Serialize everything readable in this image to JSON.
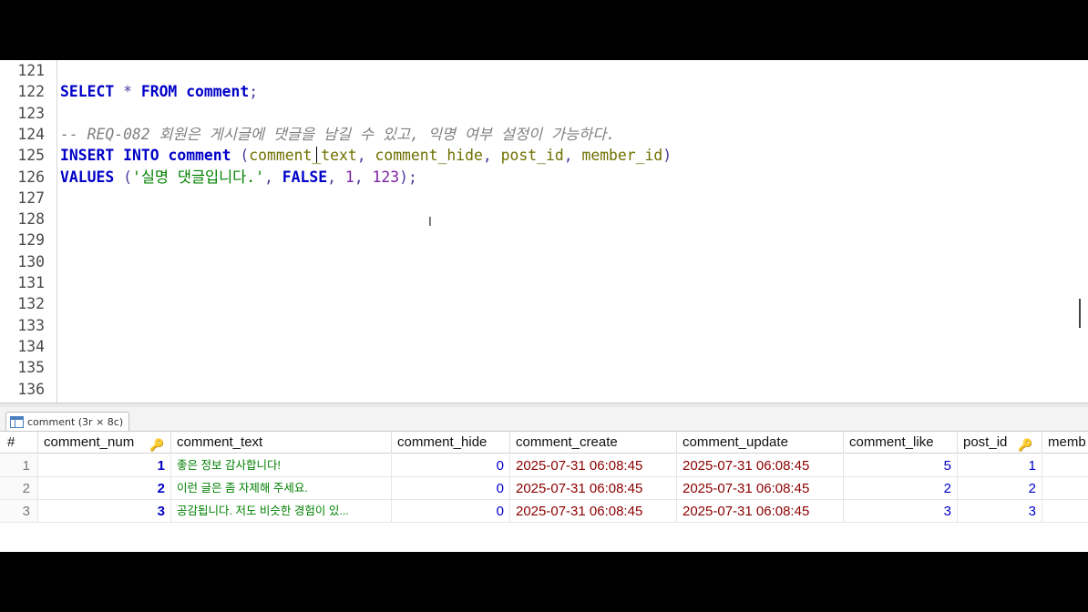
{
  "editor": {
    "lines": [
      {
        "n": "121",
        "tokens": []
      },
      {
        "n": "122",
        "tokens": [
          [
            "kw",
            "SELECT"
          ],
          [
            "op",
            " * "
          ],
          [
            "kw",
            "FROM"
          ],
          [
            "op",
            " "
          ],
          [
            "kw",
            "comment"
          ],
          [
            "op",
            ";"
          ]
        ]
      },
      {
        "n": "123",
        "tokens": []
      },
      {
        "n": "124",
        "tokens": [
          [
            "cmt",
            "-- REQ-082 회원은 게시글에 댓글을 남길 수 있고, 익명 여부 설정이 가능하다."
          ]
        ]
      },
      {
        "n": "125",
        "tokens": [
          [
            "kw",
            "INSERT"
          ],
          [
            "op",
            " "
          ],
          [
            "kw",
            "INTO"
          ],
          [
            "op",
            " "
          ],
          [
            "kw",
            "comment"
          ],
          [
            "op",
            " ("
          ],
          [
            "ident",
            "comment_text"
          ],
          [
            "op",
            ", "
          ],
          [
            "ident",
            "comment_hide"
          ],
          [
            "op",
            ", "
          ],
          [
            "ident",
            "post_id"
          ],
          [
            "op",
            ", "
          ],
          [
            "ident",
            "member_id"
          ],
          [
            "op",
            ")"
          ]
        ]
      },
      {
        "n": "126",
        "tokens": [
          [
            "kw",
            "VALUES"
          ],
          [
            "op",
            " ("
          ],
          [
            "str",
            "'실명 댓글입니다.'"
          ],
          [
            "op",
            ", "
          ],
          [
            "kw",
            "FALSE"
          ],
          [
            "op",
            ", "
          ],
          [
            "num",
            "1"
          ],
          [
            "op",
            ", "
          ],
          [
            "num",
            "123"
          ],
          [
            "op",
            ");"
          ]
        ]
      },
      {
        "n": "127",
        "tokens": []
      },
      {
        "n": "128",
        "tokens": []
      },
      {
        "n": "129",
        "tokens": []
      },
      {
        "n": "130",
        "tokens": []
      },
      {
        "n": "131",
        "tokens": []
      },
      {
        "n": "132",
        "tokens": []
      },
      {
        "n": "133",
        "tokens": []
      },
      {
        "n": "134",
        "tokens": []
      },
      {
        "n": "135",
        "tokens": []
      },
      {
        "n": "136",
        "tokens": []
      }
    ],
    "cursor_glyph": "I"
  },
  "results": {
    "tab_label": "comment (3r × 8c)",
    "row_header": "#",
    "key_glyph": "🔑",
    "columns": [
      "comment_num",
      "comment_text",
      "comment_hide",
      "comment_create",
      "comment_update",
      "comment_like",
      "post_id",
      "memb"
    ],
    "rows": [
      {
        "rn": "1",
        "comment_num": "1",
        "comment_text": "좋은 정보 감사합니다!",
        "comment_hide": "0",
        "comment_create": "2025-07-31 06:08:45",
        "comment_update": "2025-07-31 06:08:45",
        "comment_like": "5",
        "post_id": "1"
      },
      {
        "rn": "2",
        "comment_num": "2",
        "comment_text": "이런 글은 좀 자제해 주세요.",
        "comment_hide": "0",
        "comment_create": "2025-07-31 06:08:45",
        "comment_update": "2025-07-31 06:08:45",
        "comment_like": "2",
        "post_id": "2"
      },
      {
        "rn": "3",
        "comment_num": "3",
        "comment_text": "공감됩니다. 저도 비슷한 경험이 있...",
        "comment_hide": "0",
        "comment_create": "2025-07-31 06:08:45",
        "comment_update": "2025-07-31 06:08:45",
        "comment_like": "3",
        "post_id": "3"
      }
    ]
  },
  "colors": {
    "keyword": "#0000c8",
    "identifier": "#6f6f00",
    "string": "#008000",
    "number": "#7a1fa2",
    "comment": "#808080",
    "date": "#8b0000"
  }
}
